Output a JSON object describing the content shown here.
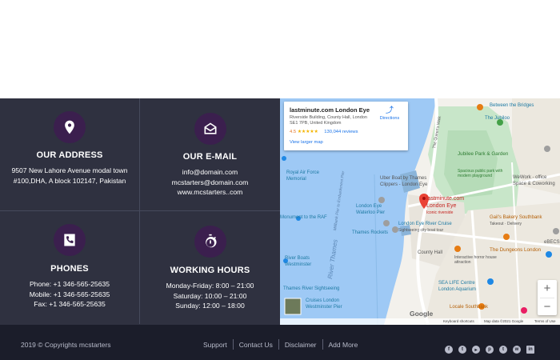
{
  "contact": {
    "address": {
      "icon": "location-pin-icon",
      "title": "OUR ADDRESS",
      "line1": "9507 New Lahore Avenue modal town",
      "line2": "#100,DHA, A block 102147, Pakistan"
    },
    "email": {
      "icon": "envelope-icon",
      "title": "OUR E-MAIL",
      "line1": "info@domain.com",
      "line2": "mcstarters@domain.com",
      "line3": "www.mcstarters..com"
    },
    "phones": {
      "icon": "phone-icon",
      "title": "PHONES",
      "line1": "Phone: +1 346-565-25635",
      "line2": "Mobile: +1 346-565-25635",
      "line3": "Fax: +1 346-565-25635"
    },
    "hours": {
      "icon": "stopwatch-icon",
      "title": "WORKING HOURS",
      "line1": "Monday-Friday: 8:00 – 21:00",
      "line2": "Saturday: 10:00 – 21:00",
      "line3": "Sunday: 12:00 – 18:00"
    }
  },
  "map": {
    "info": {
      "title": "lastminute.com London Eye",
      "address": "Riverside Building, County Hall, London SE1 7PB, United Kingdom",
      "rating": "4.5",
      "stars": "★★★★★",
      "reviews": "130,044 reviews",
      "view_larger": "View larger map",
      "directions": "Directions"
    },
    "labels": {
      "between_bridges": "Between the Bridges",
      "jubilee": "The Jubiloo",
      "jubilee_park": "Jubilee Park & Garden",
      "jubilee_park_sub": "Spacious public park with modern playground",
      "wework": "WeWork - office",
      "wework2": "Space & Coworking",
      "royal_air": "Royal Air Force",
      "memorial": "Memorial",
      "uber_boat": "Uber Boat by Thames",
      "clippers": "Clippers - London Eye",
      "london_eye_pier": "London Eye",
      "waterloo_pier": "Waterloo Pier",
      "london_eye": "lastminute.com",
      "london_eye2": "London Eye",
      "iconic": "Iconic riverside",
      "gails": "Gail's Bakery Southbank",
      "gails_sub": "Takeout · Delivery",
      "monument": "Monument to the RAF",
      "thames_rockets": "Thames Rockets",
      "river_cruise": "London Eye River Cruise",
      "river_cruise_sub": "Sightseeing city boat tour",
      "county_hall": "County Hall",
      "river_boats": "River Boats",
      "westminster": "Westminster",
      "dungeons": "The Dungeons London",
      "dungeons_sub": "Interactive horror house attraction",
      "sightseeing": "Thames River Sightseeing",
      "cruises": "Cruises London",
      "westminster_pier": "Westminster Pier",
      "sealife": "SEA LIFE Centre",
      "sealife2": "London Aquarium",
      "locale": "Locale Southbank",
      "ebec": "eBECS",
      "river_thames": "River Thames",
      "embankment": "Millbank Pier to Embankment Pier",
      "queens_walk": "The Queen's Walk",
      "google": "Google",
      "shortcuts": "Keyboard shortcuts",
      "mapdata": "Map data ©2021 Google",
      "terms": "Terms of Use",
      "zoom_in": "+",
      "zoom_out": "−"
    }
  },
  "footer": {
    "copyright": "2019 © Copyrights mcstarters",
    "links": [
      "Support",
      "Contact Us",
      "Disclaimer",
      "Add More"
    ],
    "social": [
      "facebook-icon",
      "twitter-icon",
      "youtube-icon",
      "pinterest-icon",
      "tumblr-icon",
      "wechat-icon",
      "linkedin-icon"
    ]
  },
  "colors": {
    "panel": "#2f3140",
    "icon_bg": "#3b1f4e",
    "footer": "#1b1d2a",
    "water": "#9ec9f5"
  }
}
